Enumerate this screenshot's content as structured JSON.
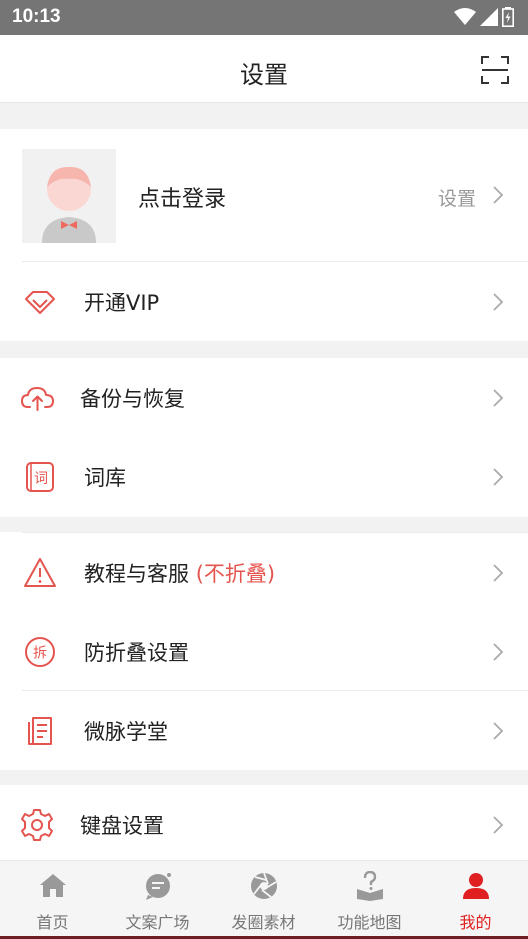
{
  "status_bar": {
    "time": "10:13",
    "icons": [
      "wifi-icon",
      "signal-icon",
      "battery-icon"
    ]
  },
  "header": {
    "title": "设置",
    "action_icon": "scan-icon"
  },
  "profile": {
    "login_label": "点击登录",
    "settings_label": "设置"
  },
  "menu": {
    "vip": {
      "label": "开通VIP",
      "icon": "diamond-icon"
    },
    "backup": {
      "label": "备份与恢复",
      "icon": "cloud-upload-icon"
    },
    "lexicon": {
      "label": "词库",
      "icon": "lexicon-icon",
      "icon_text": "词"
    },
    "tutorial": {
      "label": "教程与客服",
      "badge": "(不折叠)",
      "icon": "warning-icon"
    },
    "anti_fold": {
      "label": "防折叠设置",
      "icon": "anti-fold-icon",
      "icon_text": "拆"
    },
    "school": {
      "label": "微脉学堂",
      "icon": "document-icon"
    },
    "keyboard": {
      "label": "键盘设置",
      "icon": "gear-icon"
    }
  },
  "bottom_nav": {
    "items": [
      {
        "label": "首页",
        "icon": "home-icon"
      },
      {
        "label": "文案广场",
        "icon": "chat-icon"
      },
      {
        "label": "发圈素材",
        "icon": "aperture-icon"
      },
      {
        "label": "功能地图",
        "icon": "help-book-icon"
      },
      {
        "label": "我的",
        "icon": "user-icon",
        "active": true
      }
    ]
  },
  "colors": {
    "accent": "#e5554f",
    "active_nav": "#e02020",
    "status_bar": "#757575"
  }
}
